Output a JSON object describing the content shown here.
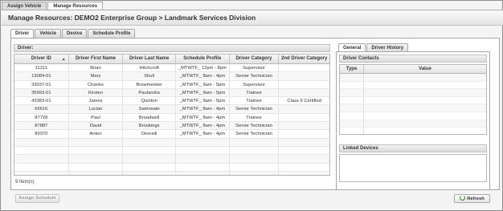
{
  "top_tabs": [
    {
      "label": "Assign Vehicle",
      "active": false
    },
    {
      "label": "Manage Resources",
      "active": true
    }
  ],
  "header": {
    "title": "Manage Resources: DEMO2 Enterprise Group > Landmark Services Division"
  },
  "main_tabs": [
    {
      "label": "Driver",
      "active": true
    },
    {
      "label": "Vehicle",
      "active": false
    },
    {
      "label": "Device",
      "active": false
    },
    {
      "label": "Schedule Profile",
      "active": false
    }
  ],
  "driver_panel": {
    "section_title": "Driver:",
    "columns": [
      "Driver ID",
      "Driver First Name",
      "Driver Last Name",
      "Schedule Profile",
      "Driver Category",
      "2nd Driver Category"
    ],
    "sorted_column": "Driver ID",
    "rows": [
      [
        "11211",
        "Brian",
        "Hitchcroft",
        "_MTWTF_ 12pm - 8pm",
        "Supervisor",
        ""
      ],
      [
        "13084-01",
        "Mary",
        "Shull",
        "_MTWTF_ 8am - 4pm",
        "Senior Technician",
        ""
      ],
      [
        "33037-01",
        "Charles",
        "Brewmeister",
        "_MTWTF_ 9am - 5pm",
        "Supervisor",
        ""
      ],
      [
        "35993-01",
        "Kirsten",
        "Paulandra",
        "_MTWTF_ 9am - 5pm",
        "Trainee",
        ""
      ],
      [
        "43383-01",
        "James",
        "Quinton",
        "_MTWTF_ 9am - 5pm",
        "Trainee",
        "Class II Certified"
      ],
      [
        "66616",
        "Lucian",
        "Samosate",
        "_MTWTF_ 8am - 4pm",
        "Senior Technician",
        ""
      ],
      [
        "87728",
        "Paul",
        "Broadwell",
        "_MTWTF_ 8am - 4pm",
        "Trainee",
        ""
      ],
      [
        "87887",
        "David",
        "Brookings",
        "_MTWTF_ 8am - 4pm",
        "Senior Technician",
        ""
      ],
      [
        "89370",
        "Anton",
        "Desraili",
        "_MTWTF_ 8am - 4pm",
        "Senior Technician",
        ""
      ]
    ],
    "item_count": "9 Item(s)"
  },
  "side_tabs": [
    {
      "label": "General",
      "active": true
    },
    {
      "label": "Driver History",
      "active": false
    }
  ],
  "contacts": {
    "section_title": "Driver Contacts",
    "columns": [
      "Type",
      "Value"
    ]
  },
  "linked_devices": {
    "section_title": "Linked Devices"
  },
  "buttons": {
    "assign_schedule": "Assign Schedule",
    "refresh": "Refresh"
  },
  "icons": {
    "refresh": "refresh-icon",
    "sort": "sort-up-icon"
  },
  "colors": {
    "accent_green": "#3a8a2e"
  }
}
